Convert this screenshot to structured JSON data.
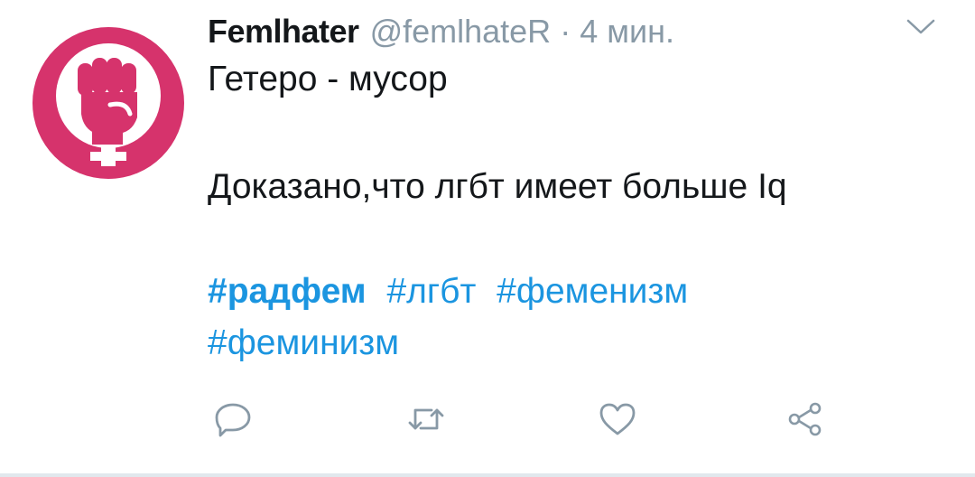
{
  "tweet": {
    "author_name": "Femlhater",
    "handle": "@femlhateR",
    "separator": "·",
    "time": "4 мин.",
    "line1": "Гетеро - мусор",
    "line2": "Доказано,что лгбт имеет больше  Iq",
    "hashtags": [
      "#радфем",
      "#лгбт",
      "#феменизм",
      "#феминизм"
    ]
  },
  "colors": {
    "avatar": "#d6336c",
    "hashtag": "#1b95e0",
    "muted": "#8899a6",
    "text": "#14171a"
  },
  "icons": [
    "caret-down-icon",
    "reply-icon",
    "retweet-icon",
    "like-icon",
    "share-icon"
  ]
}
